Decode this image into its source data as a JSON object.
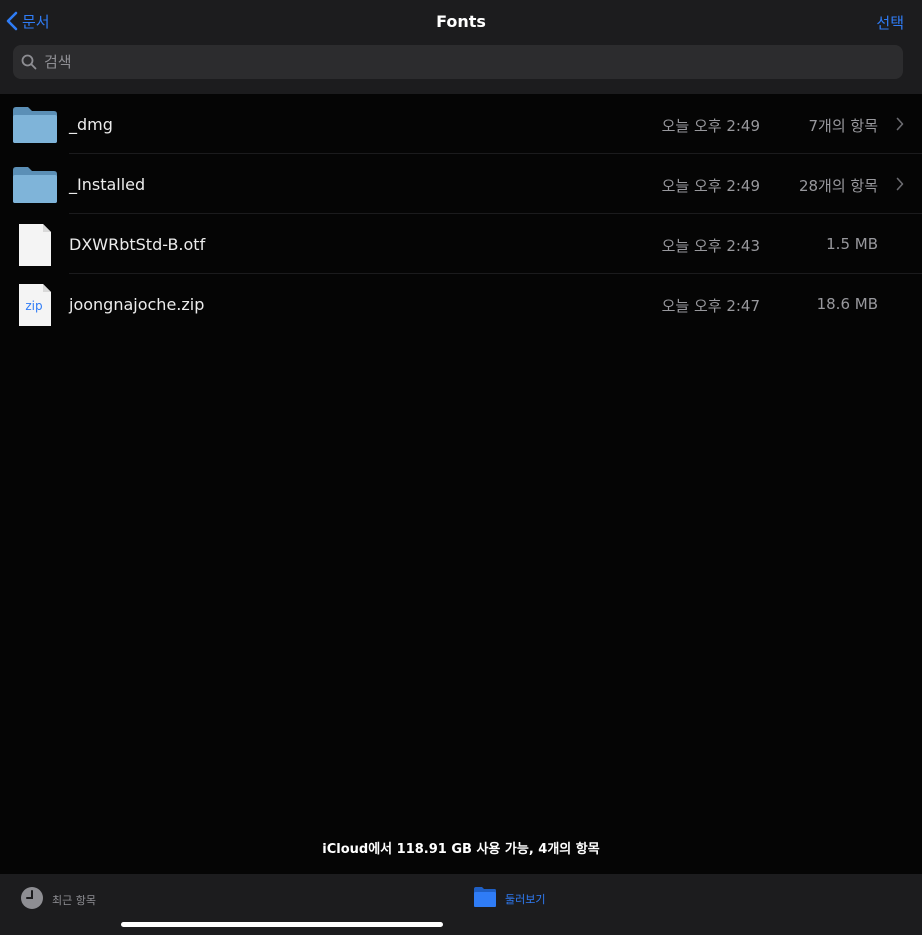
{
  "nav": {
    "back_label": "문서",
    "title": "Fonts",
    "select_label": "선택"
  },
  "search": {
    "placeholder": "검색",
    "value": ""
  },
  "files": [
    {
      "name": "_dmg",
      "date": "오늘 오후 2:49",
      "meta": "7개의 항목",
      "kind": "folder",
      "icon": "folder-icon"
    },
    {
      "name": "_Installed",
      "date": "오늘 오후 2:49",
      "meta": "28개의 항목",
      "kind": "folder",
      "icon": "folder-icon"
    },
    {
      "name": "DXWRbtStd-B.otf",
      "date": "오늘 오후 2:43",
      "meta": "1.5 MB",
      "kind": "file",
      "icon": "document-icon"
    },
    {
      "name": "joongnajoche.zip",
      "date": "오늘 오후 2:47",
      "meta": "18.6 MB",
      "kind": "zip",
      "icon": "zip-file-icon",
      "badge": "zip"
    }
  ],
  "status": "iCloud에서 118.91 GB 사용 가능, 4개의 항목",
  "tabs": {
    "recents": {
      "label": "최근 항목",
      "icon": "clock-icon"
    },
    "browse": {
      "label": "둘러보기",
      "icon": "folder-icon"
    }
  },
  "colors": {
    "accent": "#2f7cf6",
    "background": "#050505",
    "bar": "#1c1c1e",
    "folder": "#7fb4d9",
    "secondary_text": "#98989d"
  }
}
